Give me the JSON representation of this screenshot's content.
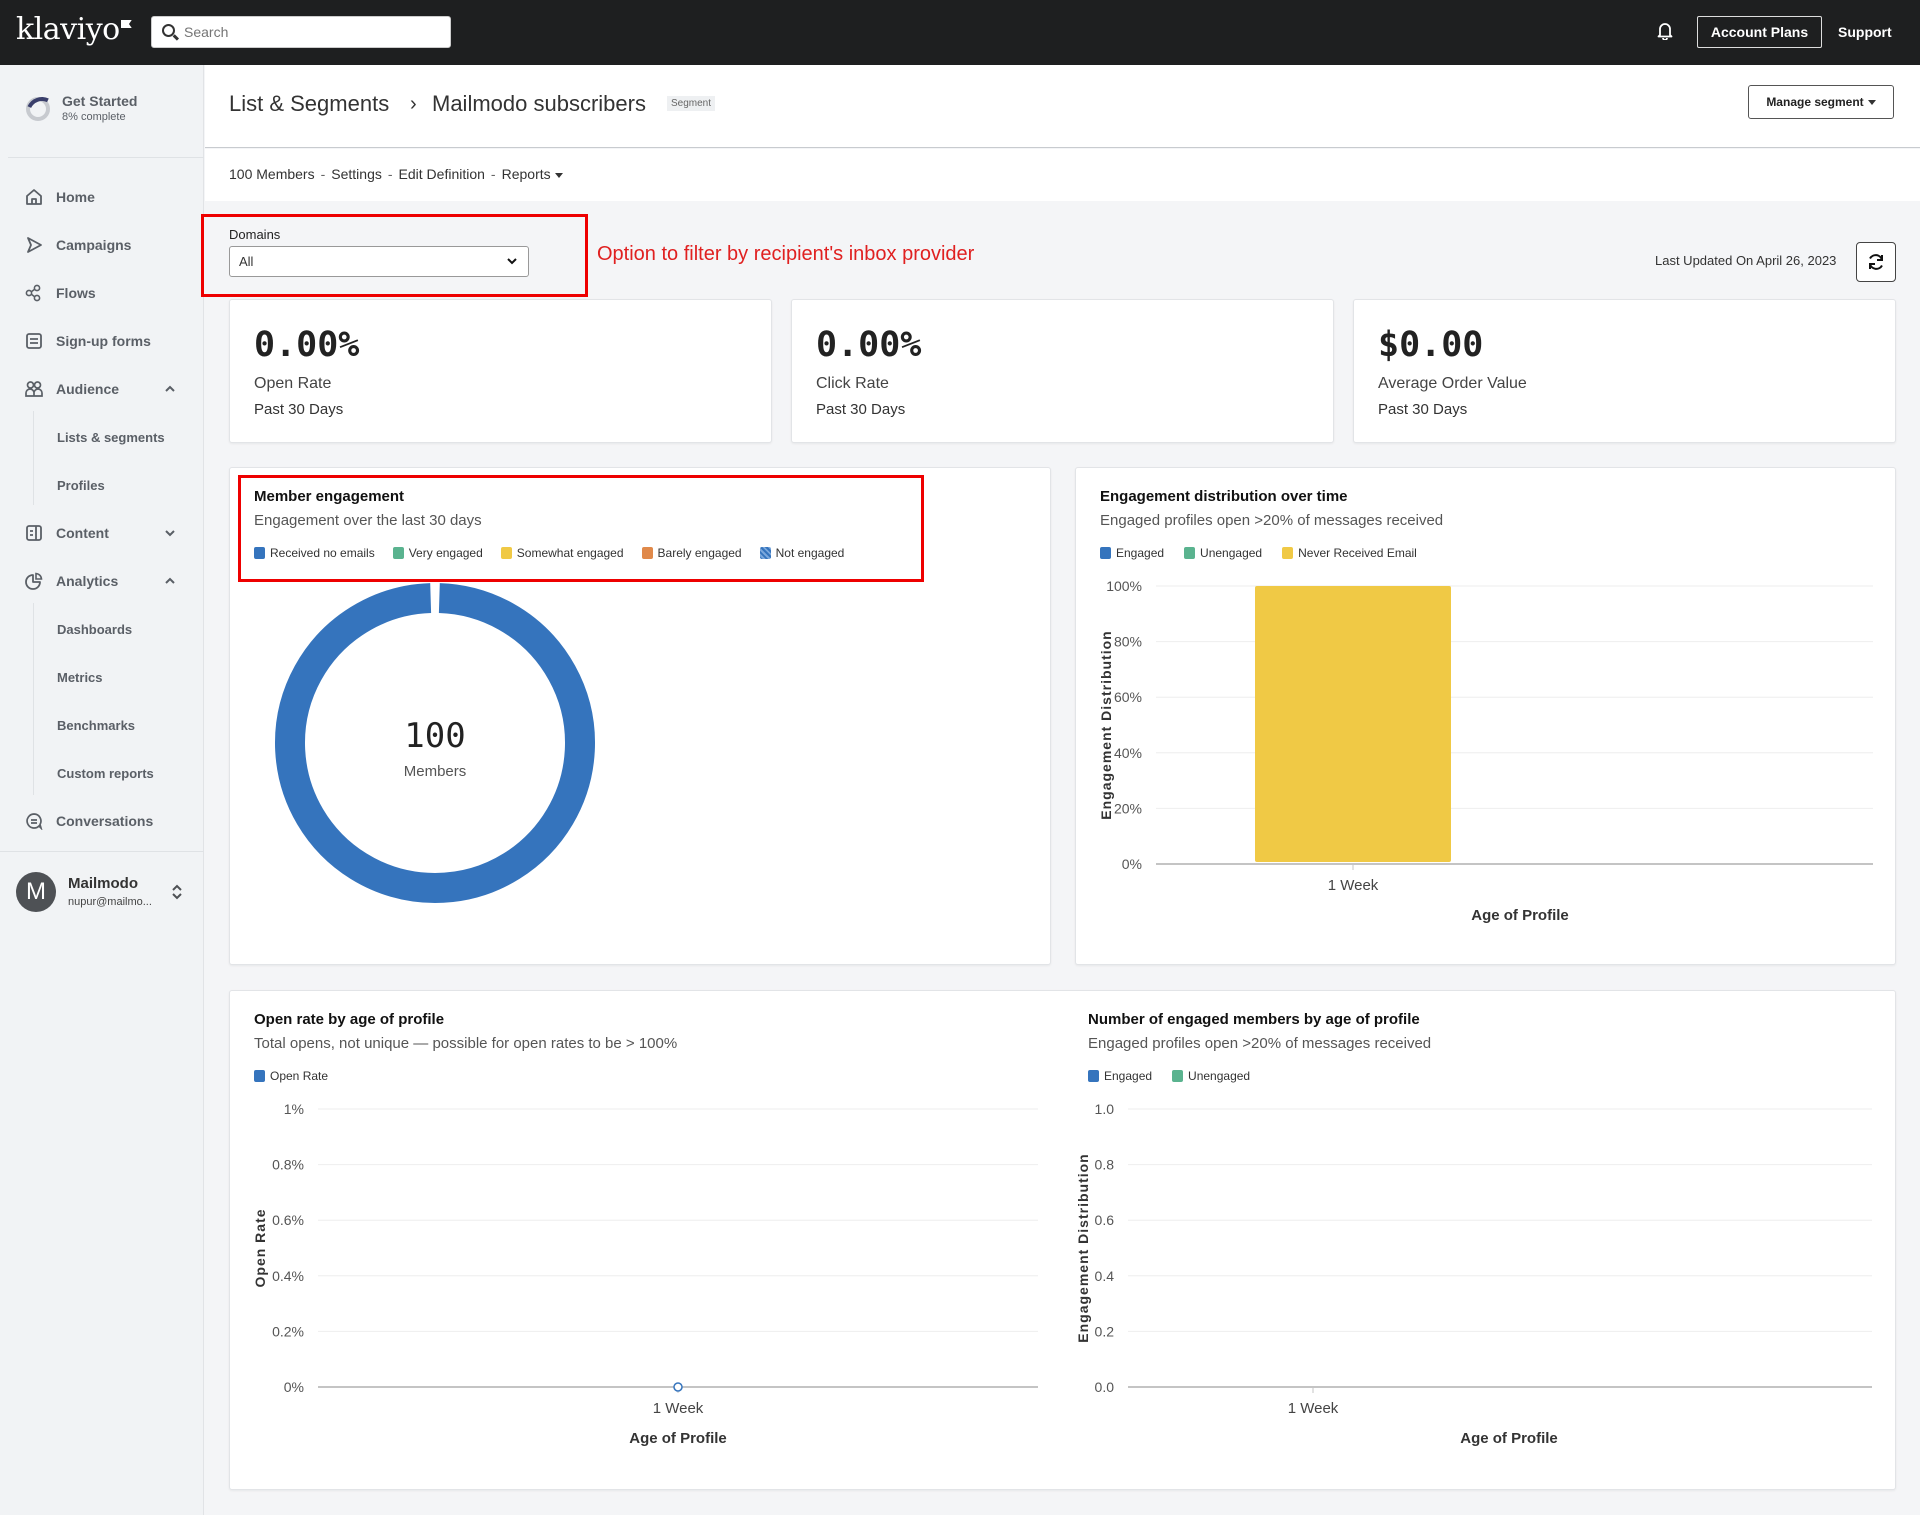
{
  "topbar": {
    "logo": "klaviyo",
    "search_placeholder": "Search",
    "account_plans": "Account Plans",
    "support": "Support"
  },
  "sidebar": {
    "get_started": {
      "title": "Get Started",
      "progress": "8% complete",
      "progress_value": 0.08
    },
    "items": [
      {
        "label": "Home",
        "icon": "home-icon"
      },
      {
        "label": "Campaigns",
        "icon": "send-icon"
      },
      {
        "label": "Flows",
        "icon": "flows-icon"
      },
      {
        "label": "Sign-up forms",
        "icon": "form-icon"
      },
      {
        "label": "Audience",
        "icon": "people-icon",
        "expanded": true
      },
      {
        "label": "Lists & segments",
        "sub": true
      },
      {
        "label": "Profiles",
        "sub": true
      },
      {
        "label": "Content",
        "icon": "content-icon",
        "expanded": false
      },
      {
        "label": "Analytics",
        "icon": "analytics-icon",
        "expanded": true
      },
      {
        "label": "Dashboards",
        "sub": true
      },
      {
        "label": "Metrics",
        "sub": true
      },
      {
        "label": "Benchmarks",
        "sub": true
      },
      {
        "label": "Custom reports",
        "sub": true
      },
      {
        "label": "Conversations",
        "icon": "chat-icon"
      }
    ],
    "user": {
      "initial": "M",
      "name": "Mailmodo",
      "email": "nupur@mailmo..."
    }
  },
  "header": {
    "breadcrumb_root": "List & Segments",
    "breadcrumb_sep": "›",
    "title": "Mailmodo subscribers",
    "badge": "Segment",
    "manage_button": "Manage segment"
  },
  "subnav": {
    "members": "100 Members",
    "settings": "Settings",
    "edit_definition": "Edit Definition",
    "reports": "Reports",
    "separator": "-"
  },
  "filter": {
    "label": "Domains",
    "value": "All",
    "annotation": "Option to filter by recipient's inbox provider"
  },
  "last_updated": "Last Updated On April 26, 2023",
  "kpis": [
    {
      "value": "0.00%",
      "label": "Open Rate",
      "period": "Past 30 Days"
    },
    {
      "value": "0.00%",
      "label": "Click Rate",
      "period": "Past 30 Days"
    },
    {
      "value": "$0.00",
      "label": "Average Order Value",
      "period": "Past 30 Days"
    }
  ],
  "colors": {
    "blue": "#3574bd",
    "green": "#5ab38f",
    "yellow": "#f0c945",
    "orange": "#e0894a",
    "annotation_red": "#ee0000"
  },
  "chart_data": [
    {
      "type": "pie",
      "title": "Member engagement",
      "subtitle": "Engagement over the last 30 days",
      "legend": [
        "Received no emails",
        "Very engaged",
        "Somewhat engaged",
        "Barely engaged",
        "Not engaged"
      ],
      "values": [
        100,
        0,
        0,
        0,
        0
      ],
      "center_value": "100",
      "center_label": "Members"
    },
    {
      "type": "bar",
      "title": "Engagement distribution over time",
      "subtitle": "Engaged profiles open >20% of messages received",
      "legend": [
        "Engaged",
        "Unengaged",
        "Never Received Email"
      ],
      "categories": [
        "1 Week"
      ],
      "series": [
        {
          "name": "Engaged",
          "values": [
            0
          ]
        },
        {
          "name": "Unengaged",
          "values": [
            0
          ]
        },
        {
          "name": "Never Received Email",
          "values": [
            100
          ]
        }
      ],
      "xlabel": "Age of Profile",
      "ylabel": "Engagement Distribution",
      "yticks": [
        "0%",
        "20%",
        "40%",
        "60%",
        "80%",
        "100%"
      ],
      "ylim": [
        0,
        100
      ],
      "stacked": true
    },
    {
      "type": "line",
      "title": "Open rate by age of profile",
      "subtitle": "Total opens, not unique — possible for open rates to be > 100%",
      "legend": [
        "Open Rate"
      ],
      "categories": [
        "1 Week"
      ],
      "series": [
        {
          "name": "Open Rate",
          "values": [
            0
          ]
        }
      ],
      "xlabel": "Age of Profile",
      "ylabel": "Open Rate",
      "yticks": [
        "0%",
        "0.2%",
        "0.4%",
        "0.6%",
        "0.8%",
        "1%"
      ],
      "ylim": [
        0,
        1
      ]
    },
    {
      "type": "bar",
      "title": "Number of engaged members by age of profile",
      "subtitle": "Engaged profiles open >20% of messages received",
      "legend": [
        "Engaged",
        "Unengaged"
      ],
      "categories": [
        "1 Week"
      ],
      "series": [
        {
          "name": "Engaged",
          "values": [
            0
          ]
        },
        {
          "name": "Unengaged",
          "values": [
            0
          ]
        }
      ],
      "xlabel": "Age of Profile",
      "ylabel": "Engagement Distribution",
      "yticks": [
        "0.0",
        "0.2",
        "0.4",
        "0.6",
        "0.8",
        "1.0"
      ],
      "ylim": [
        0,
        1
      ]
    }
  ]
}
